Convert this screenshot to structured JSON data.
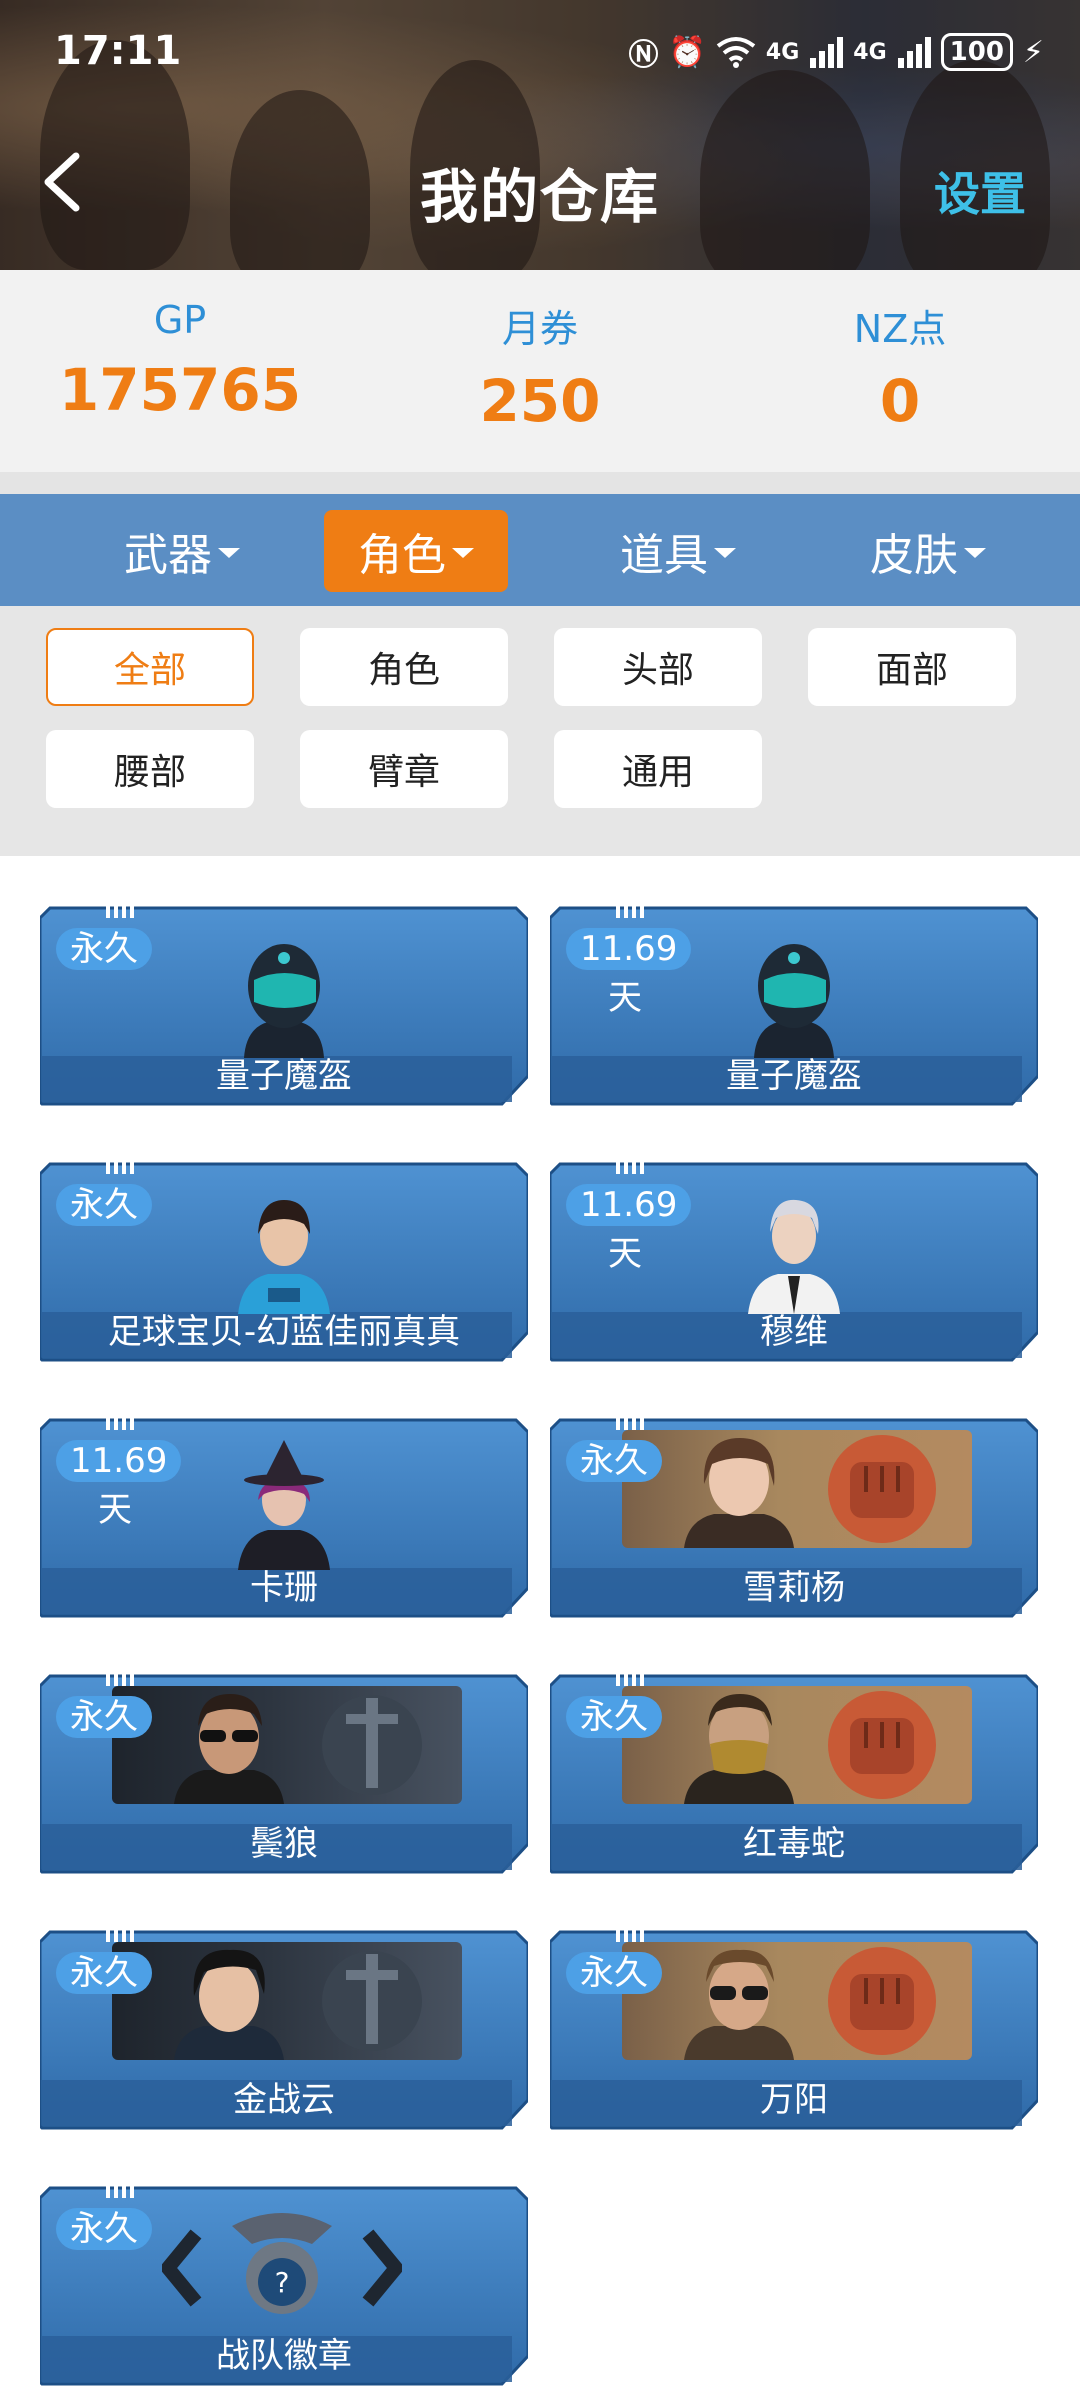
{
  "status_bar": {
    "time": "17:11",
    "battery": "100",
    "network": "4G"
  },
  "header": {
    "title": "我的仓库",
    "settings_label": "设置"
  },
  "currency": [
    {
      "label": "GP",
      "value": "175765"
    },
    {
      "label": "月券",
      "value": "250"
    },
    {
      "label": "NZ点",
      "value": "0"
    }
  ],
  "categories": [
    {
      "label": "武器",
      "active": false
    },
    {
      "label": "角色",
      "active": true
    },
    {
      "label": "道具",
      "active": false
    },
    {
      "label": "皮肤",
      "active": false
    }
  ],
  "filters": [
    {
      "label": "全部",
      "active": true
    },
    {
      "label": "角色",
      "active": false
    },
    {
      "label": "头部",
      "active": false
    },
    {
      "label": "面部",
      "active": false
    },
    {
      "label": "腰部",
      "active": false
    },
    {
      "label": "臂章",
      "active": false
    },
    {
      "label": "通用",
      "active": false
    }
  ],
  "items": [
    {
      "name": "量子魔盔",
      "duration": "永久",
      "duration_unit": "",
      "icon": "helmet-icon"
    },
    {
      "name": "量子魔盔",
      "duration": "11.69",
      "duration_unit": "天",
      "icon": "helmet-icon"
    },
    {
      "name": "足球宝贝-幻蓝佳丽真真",
      "duration": "永久",
      "duration_unit": "",
      "icon": "character-icon"
    },
    {
      "name": "穆维",
      "duration": "11.69",
      "duration_unit": "天",
      "icon": "character-icon"
    },
    {
      "name": "卡珊",
      "duration": "11.69",
      "duration_unit": "天",
      "icon": "character-icon"
    },
    {
      "name": "雪莉杨",
      "duration": "永久",
      "duration_unit": "",
      "icon": "fist-emblem-icon"
    },
    {
      "name": "鬓狼",
      "duration": "永久",
      "duration_unit": "",
      "icon": "sword-emblem-icon"
    },
    {
      "name": "红毒蛇",
      "duration": "永久",
      "duration_unit": "",
      "icon": "fist-emblem-icon"
    },
    {
      "name": "金战云",
      "duration": "永久",
      "duration_unit": "",
      "icon": "sword-emblem-icon"
    },
    {
      "name": "万阳",
      "duration": "永久",
      "duration_unit": "",
      "icon": "fist-emblem-icon"
    },
    {
      "name": "战队徽章",
      "duration": "永久",
      "duration_unit": "",
      "icon": "badge-emblem-icon"
    }
  ],
  "colors": {
    "accent": "#ef7d14",
    "tab_bar": "#5b8ec4",
    "label_blue": "#2e8fd6",
    "settings": "#3ec0e8",
    "card_blue": "#3f7fc0"
  }
}
